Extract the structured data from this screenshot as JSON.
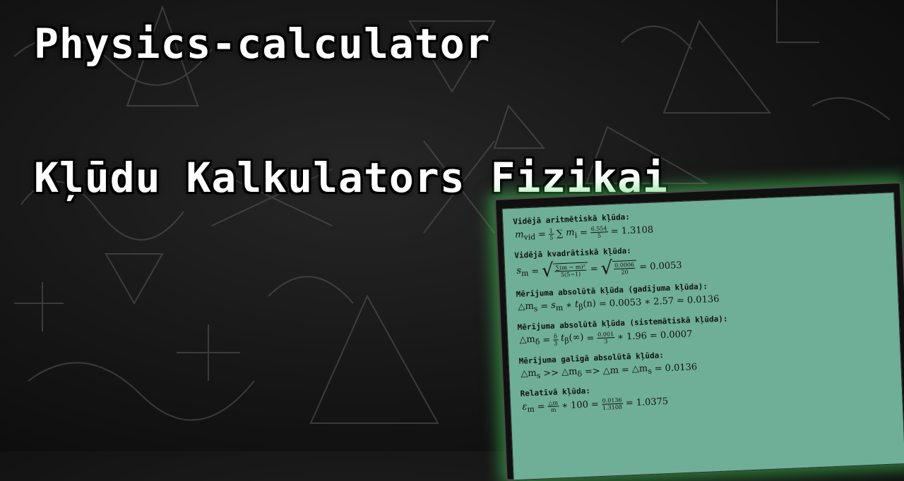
{
  "header": {
    "title_en": "Physics-calculator",
    "title_lv": "Kļūdu Kalkulators Fizikai"
  },
  "panel": {
    "sections": [
      {
        "label": "Vidējā aritmētiskā kļūda:"
      },
      {
        "label": "Vidējā kvadrātiskā kļūda:"
      },
      {
        "label": "Mērījuma absolūtā kļūda (gadījuma kļūda):"
      },
      {
        "label": "Mērījuma absolūtā kļūda (sistemātiskā kļūda):"
      },
      {
        "label": "Mērījuma galīgā absolūtā kļūda:"
      },
      {
        "label": "Relatīvā kļūda:"
      }
    ],
    "f1": {
      "lhs": "m",
      "lhs_sub": "vid",
      "eq1": "=",
      "frac1_num": "1",
      "frac1_den": "5",
      "sum": "∑",
      "sum_range": "5 i=1",
      "term": "m",
      "term_sub": "i",
      "eq2": "=",
      "frac2_num": "6.554",
      "frac2_den": "5",
      "eq3": "=",
      "result": "1.3108"
    },
    "f2": {
      "lhs": "s",
      "lhs_sub": "m",
      "eq1": "=",
      "inner_num": "∑(m − m)²",
      "inner_den": "5(5−1)",
      "eq2": "=",
      "val_num": "0.0006",
      "val_den": "20",
      "eq3": "=",
      "result": "0.0053"
    },
    "f3": {
      "lhs": "△m",
      "lhs_sub": "s",
      "eq1": "=",
      "rhs": "s",
      "rhs_sub": "m",
      "times": "∗",
      "t": "t",
      "t_sub": "β",
      "t_arg": "(n)",
      "eq2": "=",
      "a": "0.0053",
      "times2": "∗",
      "b": "2.57",
      "eq3": "=",
      "result": "0.0136"
    },
    "f4": {
      "lhs": "△m",
      "lhs_sub": "δ",
      "eq1": "=",
      "frac1_num": "δ",
      "frac1_den": "3",
      "t": "t",
      "t_sub": "β",
      "t_arg": "(∞)",
      "eq2": "=",
      "frac2_num": "0.001",
      "frac2_den": "3",
      "times": "∗",
      "b": "1.96",
      "eq3": "=",
      "result": "0.0007"
    },
    "f5": {
      "lhs": "△m",
      "lhs_sub": "s",
      "gt": ">>",
      "mid": "△m",
      "mid_sub": "δ",
      "arrow": "=>",
      "final": "△m",
      "eq1": "=",
      "rhs": "△m",
      "rhs_sub": "s",
      "eq2": "=",
      "result": "0.0136"
    },
    "f6": {
      "lhs": "ε",
      "lhs_sub": "m",
      "eq1": "=",
      "frac1_num": "△m",
      "frac1_den": "m",
      "times": "∗",
      "hundred": "100",
      "eq2": "=",
      "frac2_num": "0.0136",
      "frac2_den": "1.3108",
      "eq3": "=",
      "result": "1.0375"
    }
  }
}
